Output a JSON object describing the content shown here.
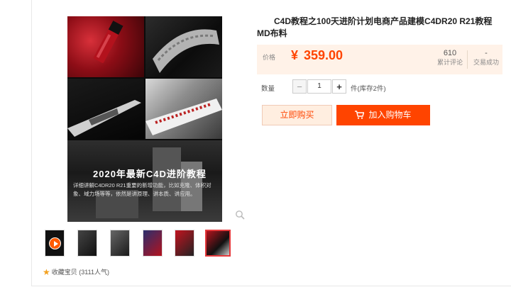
{
  "product": {
    "title": "C4D教程之100天进阶计划电商产品建模C4DR20 R21教程MD布料",
    "banner_title": "2020年最新C4D进阶教程",
    "banner_desc": "详细讲解C4DR20 R21重要的新增功能，比如克隆、体积对象、域力场等等，依然是讲原理、讲本质、讲应用。"
  },
  "price": {
    "label": "价格",
    "currency": "¥",
    "value": "359.00",
    "color": "#ff4400"
  },
  "stats": {
    "reviews_count": "610",
    "reviews_label": "累计评论",
    "deals_count": "-",
    "deals_label": "交易成功"
  },
  "quantity": {
    "label": "数量",
    "minus": "−",
    "plus": "+",
    "value": "1",
    "unit_stock": "件(库存2件)"
  },
  "buttons": {
    "buy_now": "立即购买",
    "add_cart": "加入购物车"
  },
  "favorite": {
    "label": "收藏宝贝",
    "popularity": "(3111人气)"
  },
  "thumbnails": [
    {
      "name": "video",
      "selected": false
    },
    {
      "name": "image-1",
      "selected": false
    },
    {
      "name": "image-2",
      "selected": false
    },
    {
      "name": "image-3",
      "selected": false
    },
    {
      "name": "image-4",
      "selected": false
    },
    {
      "name": "image-5",
      "selected": true
    }
  ],
  "icons": {
    "zoom": "magnifier-icon",
    "cart": "shopping-cart-icon",
    "star": "star-icon",
    "play": "play-icon"
  }
}
